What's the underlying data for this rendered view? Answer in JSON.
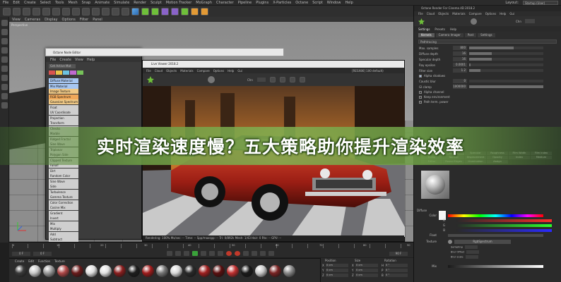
{
  "menubar": {
    "items": [
      "File",
      "Edit",
      "Create",
      "Select",
      "Tools",
      "Mesh",
      "Snap",
      "Animate",
      "Simulate",
      "Render",
      "Sculpt",
      "Motion Tracker",
      "MoGraph",
      "Character",
      "Pipeline",
      "Plugins",
      "X-Particles",
      "Octane",
      "Script",
      "Window",
      "Help"
    ],
    "layout_label": "Layout:",
    "layout_value": "Startup (User)"
  },
  "viewport": {
    "menu": [
      "View",
      "Cameras",
      "Display",
      "Options",
      "Filter",
      "Panel"
    ],
    "label": "Perspective"
  },
  "node_editor": {
    "title": "Octane Node Editor",
    "menu": [
      "File",
      "Create",
      "View",
      "Help"
    ],
    "button": "Get Active Mat",
    "nodes": [
      {
        "label": "Diffuse Material",
        "color": "#a7c7f2"
      },
      {
        "label": "Mix Material",
        "color": "#a7c7f2"
      },
      {
        "label": "Image Texture",
        "color": "#f0c986"
      },
      {
        "label": "RGB Spectrum",
        "color": "#f0a85a"
      },
      {
        "label": "Gaussian Spectrum",
        "color": "#f0c986"
      },
      {
        "label": "Float",
        "color": "#cfcfcf"
      },
      {
        "label": "UV Coordinate",
        "color": "#cfcfcf"
      },
      {
        "label": "Projection",
        "color": "#cfcfcf"
      },
      {
        "label": "Transform",
        "color": "#cfcfcf"
      },
      {
        "label": "Checks",
        "color": "#cfcfcf"
      },
      {
        "label": "Marble",
        "color": "#cfcfcf"
      },
      {
        "label": "Ridged Fractal",
        "color": "#cfcfcf"
      },
      {
        "label": "Sine Wave",
        "color": "#cfcfcf"
      },
      {
        "label": "Triplanar",
        "color": "#cfcfcf"
      },
      {
        "label": "Polygon Side",
        "color": "#cfcfcf"
      },
      {
        "label": "Clipped Texture",
        "color": "#cfcfcf"
      },
      {
        "label": "Falloff",
        "color": "#cfcfcf"
      },
      {
        "label": "Dirt",
        "color": "#cfcfcf"
      },
      {
        "label": "Random Color",
        "color": "#cfcfcf"
      },
      {
        "label": "Sine Wave",
        "color": "#cfcfcf"
      },
      {
        "label": "Side",
        "color": "#cfcfcf"
      },
      {
        "label": "Turbulence",
        "color": "#cfcfcf"
      },
      {
        "label": "Gamma Texture",
        "color": "#cfcfcf"
      },
      {
        "label": "Color Correction",
        "color": "#cfcfcf"
      },
      {
        "label": "Cosine Mix",
        "color": "#cfcfcf"
      },
      {
        "label": "Gradient",
        "color": "#cfcfcf"
      },
      {
        "label": "Invert",
        "color": "#cfcfcf"
      },
      {
        "label": "Mix",
        "color": "#cfcfcf"
      },
      {
        "label": "Multiply",
        "color": "#cfcfcf"
      },
      {
        "label": "Add",
        "color": "#cfcfcf"
      },
      {
        "label": "Subtract",
        "color": "#cfcfcf"
      }
    ]
  },
  "live_viewer": {
    "title": "Live Viewer 2018.2",
    "menu": [
      "File",
      "Cloud",
      "Objects",
      "Materials",
      "Compare",
      "Options",
      "Help",
      "Gui"
    ],
    "info": "[RESX86] 100 default)",
    "chn_label": "Chn",
    "status": "Rendering: 100%   Ms/sec: --   Time: --   Spp/maxspp: --   Tri: 0/892k   Mesh: 1/43   Hair: 0   Rtx: --   GPU: --"
  },
  "octane_panel": {
    "title": "Octane Render For Cinema 4D 2018.2",
    "menu": [
      "File",
      "Cloud",
      "Objects",
      "Materials",
      "Compare",
      "Options",
      "Help",
      "Gui"
    ],
    "chn_label": "Chn",
    "tabs": [
      "Settings",
      "Presets",
      "Help"
    ],
    "subtabs": [
      "Kernels",
      "Camera Imager",
      "Post",
      "Settings"
    ],
    "kernel": "Pathtracing",
    "rows": [
      {
        "label": "Max. samples",
        "value": "800",
        "fill": 0.6
      },
      {
        "label": "Diffuse depth",
        "value": "16",
        "fill": 0.3
      },
      {
        "label": "Specular depth",
        "value": "16",
        "fill": 0.3
      },
      {
        "label": "Ray epsilon",
        "value": "0.0001",
        "fill": 0.02
      },
      {
        "label": "Filter size",
        "value": "1.2",
        "fill": 0.15
      }
    ],
    "check1": "Alpha shadows",
    "row_clamp": {
      "label": "Caustic blur",
      "value": "0",
      "fill": 0.0
    },
    "row_gi": {
      "label": "GI clamp",
      "value": "1000000",
      "fill": 1.0
    },
    "checks": [
      "Alpha channel",
      "Keep environment",
      "Path term. power"
    ]
  },
  "material_panel": {
    "tabs": [
      "Basic",
      "Diffuse",
      "Specular",
      "Roughness",
      "Film Width",
      "Film index",
      "Bump",
      "Normal",
      "Displacement",
      "Opacity",
      "Index",
      "Medium",
      "Editor",
      "Round Edges",
      "Illumination",
      "Assign"
    ],
    "active_tab": "Diffuse",
    "section": "Diffuse",
    "color_label": "Color",
    "r": "R",
    "g": "G",
    "b": "B",
    "float_label": "Float",
    "texture_label": "Texture",
    "texture_button": "RgbSpectrum",
    "sampling": "Sampling",
    "blur_offset": "Blur Offset",
    "blur_scale": "Blur scale",
    "mix_label": "Mix"
  },
  "timeline": {
    "ticks": [
      "0",
      "10",
      "20",
      "30",
      "40",
      "50",
      "60",
      "70",
      "80",
      "90"
    ],
    "start": "0 F",
    "end": "90 F",
    "cur": "0 F"
  },
  "material_manager": {
    "menu": [
      "Create",
      "Edit",
      "Function",
      "Texture"
    ],
    "balls": [
      "#3a3a3a",
      "#c8c8c8",
      "#9a9a9a",
      "#b04848",
      "#6a1b1b",
      "#e0e0e0",
      "#e0e0e0",
      "#8a1e1e",
      "#1e1e1e",
      "#a01c1c",
      "#777",
      "#d8d8d8",
      "#2a2a2a",
      "#a02020",
      "#5a0f0f",
      "#c03030",
      "#1a1a1a",
      "#c9c9c9",
      "#7a2424",
      "#888"
    ]
  },
  "coords": {
    "headers": [
      "Position",
      "Size",
      "Rotation"
    ],
    "rows": [
      {
        "axes": [
          "X",
          "X",
          "H"
        ],
        "values": [
          "0 cm",
          "0 cm",
          "0 °"
        ]
      },
      {
        "axes": [
          "Y",
          "Y",
          "P"
        ],
        "values": [
          "0 cm",
          "0 cm",
          "0 °"
        ]
      },
      {
        "axes": [
          "Z",
          "Z",
          "B"
        ],
        "values": [
          "0 cm",
          "0 cm",
          "0 °"
        ]
      }
    ]
  },
  "banner": {
    "text": "实时渲染速度慢？五大策略助你提升渲染效率"
  },
  "colors": {
    "banner_green": "#82af50",
    "octane_green": "#6fbf3a"
  }
}
